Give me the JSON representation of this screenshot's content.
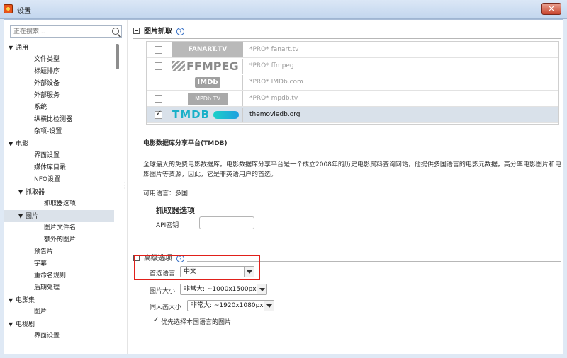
{
  "window": {
    "title": "设置",
    "close_label": "✕"
  },
  "sidebar": {
    "search_placeholder": "正在搜索...",
    "items": [
      {
        "label": "通用",
        "level": 0,
        "expander": "▼"
      },
      {
        "label": "文件类型",
        "level": 2
      },
      {
        "label": "标题排序",
        "level": 2
      },
      {
        "label": "外部设备",
        "level": 2
      },
      {
        "label": "外部服务",
        "level": 2
      },
      {
        "label": "系统",
        "level": 2
      },
      {
        "label": "纵横比检测器",
        "level": 2
      },
      {
        "label": "杂项-设置",
        "level": 2
      },
      {
        "label": "电影",
        "level": 0,
        "expander": "▼"
      },
      {
        "label": "界面设置",
        "level": 2
      },
      {
        "label": "媒体库目录",
        "level": 2
      },
      {
        "label": "NFO设置",
        "level": 2
      },
      {
        "label": "抓取器",
        "level": 1,
        "expander": "▼"
      },
      {
        "label": "抓取器选项",
        "level": 3
      },
      {
        "label": "图片",
        "level": 1,
        "expander": "▼",
        "selected": true
      },
      {
        "label": "图片文件名",
        "level": 3
      },
      {
        "label": "额外的图片",
        "level": 3
      },
      {
        "label": "预告片",
        "level": 2
      },
      {
        "label": "字幕",
        "level": 2
      },
      {
        "label": "重命名规则",
        "level": 2
      },
      {
        "label": "后期处理",
        "level": 2
      },
      {
        "label": "电影集",
        "level": 0,
        "expander": "▼"
      },
      {
        "label": "图片",
        "level": 2
      },
      {
        "label": "电视剧",
        "level": 0,
        "expander": "▼"
      },
      {
        "label": "界面设置",
        "level": 2
      }
    ]
  },
  "artwork": {
    "heading": "图片抓取",
    "help_icon": "?",
    "scrapers": [
      {
        "name": "*PRO* fanart.tv",
        "logo_text": "FANART.TV",
        "logo": "fanart",
        "checked": false
      },
      {
        "name": "*PRO* ffmpeg",
        "logo_text": "FFMPEG",
        "logo": "ffmpeg",
        "checked": false
      },
      {
        "name": "*PRO* IMDb.com",
        "logo_text": "IMDb",
        "logo": "imdb",
        "checked": false
      },
      {
        "name": "*PRO* mpdb.tv",
        "logo_text": "MPDb.TV",
        "logo": "mpdb",
        "checked": false
      },
      {
        "name": "themoviedb.org",
        "logo_text": "TMDB",
        "logo": "tmdb",
        "checked": true,
        "active": true
      }
    ],
    "desc_title": "电影数据库分享平台(TMDB)",
    "desc_body": "全球最大的免费电影数据库。电影数据库分享平台是一个成立2008年的历史电影资料查询网站，他提供多国语言的电影元数据，高分率电影图片和电影图片等资源，因此，它是非英语用户的首选。",
    "languages": "可用语言：多国",
    "options_title": "抓取器选项",
    "api_label": "API密钥",
    "api_value": ""
  },
  "advanced": {
    "heading": "高级选项",
    "help_icon": "?",
    "preferred_language_label": "首选语言",
    "preferred_language_value": "中文",
    "poster_size_label": "图片大小",
    "poster_size_value": "非常大: ~1000x1500px",
    "fanart_size_label": "同人画大小",
    "fanart_size_value": "非常大: ~1920x1080px",
    "prefer_language_label": "优先选择本国语言的图片",
    "prefer_language_checked": true
  },
  "colors": {
    "highlight": "#e0201a",
    "tmdb": "#19b0c8"
  }
}
